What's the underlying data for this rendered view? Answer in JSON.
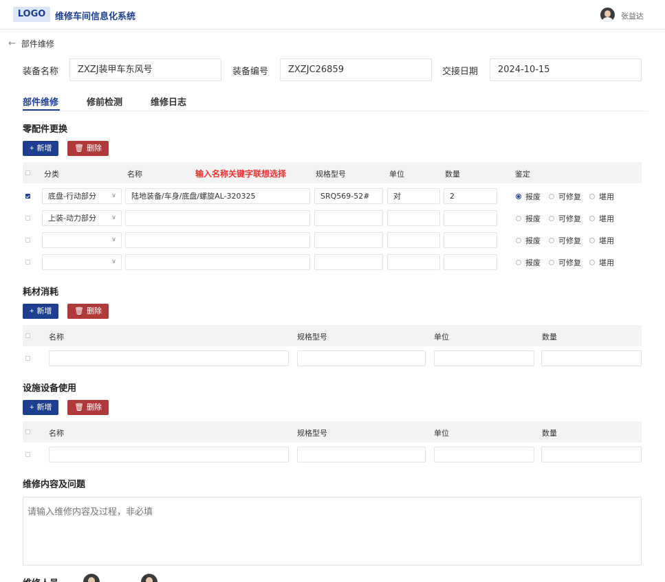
{
  "header": {
    "logo": "LOGO",
    "title": "维修车间信息化系统",
    "user_name": "张益达"
  },
  "breadcrumb": {
    "back_label": "部件维修"
  },
  "info": {
    "equip_name_label": "装备名称",
    "equip_name_value": "ZXZJ装甲车东风号",
    "equip_no_label": "装备编号",
    "equip_no_value": "ZXZJC26859",
    "date_label": "交接日期",
    "date_value": "2024-10-15"
  },
  "tabs": [
    {
      "label": "部件维修",
      "active": true
    },
    {
      "label": "修前检测",
      "active": false
    },
    {
      "label": "维修日志",
      "active": false
    }
  ],
  "buttons": {
    "add": "新增",
    "delete": "删除"
  },
  "parts": {
    "title": "零配件更换",
    "headers": {
      "category": "分类",
      "name": "名称",
      "hint": "输入名称关键字联想选择",
      "spec": "规格型号",
      "unit": "单位",
      "qty": "数量",
      "judge": "鉴定"
    },
    "judge_options": [
      "报废",
      "可修复",
      "堪用"
    ],
    "rows": [
      {
        "checked": true,
        "category": "底盘-行动部分",
        "name": "陆地装备/车身/底盘/螺旋AL-320325",
        "spec": "SRQ569-52#",
        "unit": "对",
        "qty": "2",
        "judge": 0
      },
      {
        "checked": false,
        "category": "上装-动力部分",
        "name": "",
        "spec": "",
        "unit": "",
        "qty": "",
        "judge": -1
      },
      {
        "checked": false,
        "category": "",
        "name": "",
        "spec": "",
        "unit": "",
        "qty": "",
        "judge": -1
      },
      {
        "checked": false,
        "category": "",
        "name": "",
        "spec": "",
        "unit": "",
        "qty": "",
        "judge": -1
      }
    ]
  },
  "materials": {
    "title": "耗材消耗",
    "headers": {
      "name": "名称",
      "spec": "规格型号",
      "unit": "单位",
      "qty": "数量"
    }
  },
  "facilities": {
    "title": "设施设备使用",
    "headers": {
      "name": "名称",
      "spec": "规格型号",
      "unit": "单位",
      "qty": "数量"
    }
  },
  "content": {
    "title": "维修内容及问题",
    "placeholder": "请输入维修内容及过程，非必填"
  },
  "personnel": {
    "label": "维修人员"
  },
  "colors": {
    "primary": "#1d3f8f",
    "danger": "#b03a3a",
    "hint": "#ee3333"
  },
  "icons": {
    "back": "arrow-left-icon",
    "add": "plus-icon",
    "delete": "trash-icon",
    "select": "chevron-down-icon"
  }
}
